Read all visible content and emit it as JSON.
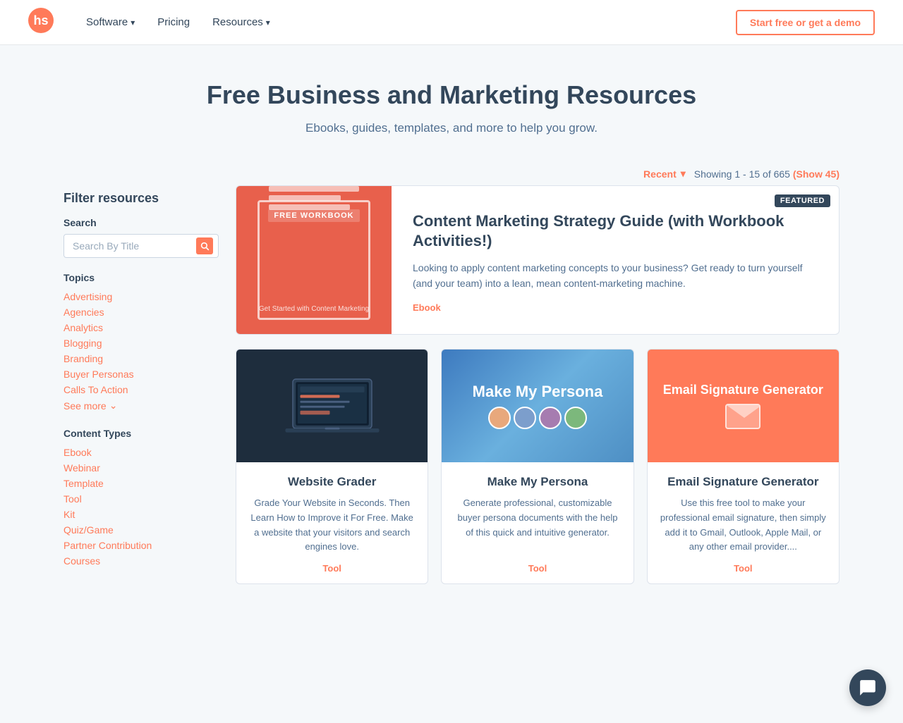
{
  "nav": {
    "logo_label": "HubSpot",
    "links": [
      {
        "label": "Software",
        "has_dropdown": true
      },
      {
        "label": "Pricing",
        "has_dropdown": false
      },
      {
        "label": "Resources",
        "has_dropdown": true
      }
    ],
    "cta_label": "Start free or get a demo"
  },
  "hero": {
    "title": "Free Business and Marketing Resources",
    "subtitle": "Ebooks, guides, templates, and more to help you grow."
  },
  "toolbar": {
    "sort_label": "Recent",
    "showing_text": "Showing 1 - 15 of 665",
    "show_link": "(Show 45)"
  },
  "sidebar": {
    "filter_title": "Filter resources",
    "search_label": "Search",
    "search_placeholder": "Search By Title",
    "topics_label": "Topics",
    "topics": [
      "Advertising",
      "Agencies",
      "Analytics",
      "Blogging",
      "Branding",
      "Buyer Personas",
      "Calls To Action"
    ],
    "see_more_label": "See more",
    "content_types_label": "Content Types",
    "content_types": [
      "Ebook",
      "Webinar",
      "Template",
      "Tool",
      "Kit",
      "Quiz/Game",
      "Partner Contribution",
      "Courses"
    ]
  },
  "featured_card": {
    "badge": "FEATURED",
    "img_label": "FREE WORKBOOK",
    "img_subtitle": "Get Started with Content Marketing",
    "title": "Content Marketing Strategy Guide (with Workbook Activities!)",
    "description": "Looking to apply content marketing concepts to your business? Get ready to turn yourself (and your team) into a lean, mean content-marketing machine.",
    "type": "Ebook"
  },
  "grid_cards": [
    {
      "img_type": "website",
      "title": "Website Grader",
      "description": "Grade Your Website in Seconds. Then Learn How to Improve it For Free. Make a website that your visitors and search engines love.",
      "type": "Tool"
    },
    {
      "img_type": "persona",
      "img_title": "Make My Persona",
      "title": "Make My Persona",
      "description": "Generate professional, customizable buyer persona documents with the help of this quick and intuitive generator.",
      "type": "Tool"
    },
    {
      "img_type": "email",
      "img_title": "Email Signature Generator",
      "title": "Email Signature Generator",
      "description": "Use this free tool to make your professional email signature, then simply add it to Gmail, Outlook, Apple Mail, or any other email provider....",
      "type": "Tool"
    }
  ],
  "chat": {
    "label": "Chat support"
  },
  "accent_color": "#ff7a59",
  "text_color": "#33475b"
}
